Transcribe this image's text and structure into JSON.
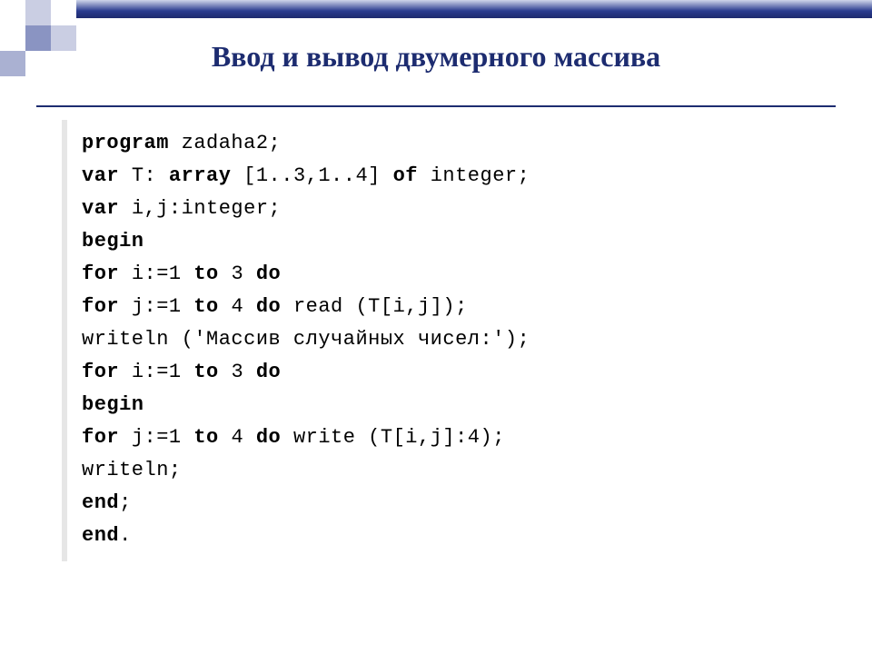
{
  "title": "Ввод и вывод двумерного массива",
  "code": {
    "lines": [
      {
        "segments": [
          {
            "t": "program ",
            "kw": true
          },
          {
            "t": "zadaha2;",
            "kw": false
          }
        ]
      },
      {
        "segments": [
          {
            "t": "var ",
            "kw": true
          },
          {
            "t": "T: ",
            "kw": false
          },
          {
            "t": "array ",
            "kw": true
          },
          {
            "t": "[1..3,1..4] ",
            "kw": false
          },
          {
            "t": "of ",
            "kw": true
          },
          {
            "t": "integer;",
            "kw": false
          }
        ]
      },
      {
        "segments": [
          {
            "t": "var ",
            "kw": true
          },
          {
            "t": "i,j:integer;",
            "kw": false
          }
        ]
      },
      {
        "segments": [
          {
            "t": "begin",
            "kw": true
          }
        ]
      },
      {
        "segments": [
          {
            "t": "for ",
            "kw": true
          },
          {
            "t": "i:=1 ",
            "kw": false
          },
          {
            "t": "to ",
            "kw": true
          },
          {
            "t": "3 ",
            "kw": false
          },
          {
            "t": "do",
            "kw": true
          }
        ]
      },
      {
        "segments": [
          {
            "t": "for ",
            "kw": true
          },
          {
            "t": "j:=1 ",
            "kw": false
          },
          {
            "t": "to ",
            "kw": true
          },
          {
            "t": "4 ",
            "kw": false
          },
          {
            "t": "do ",
            "kw": true
          },
          {
            "t": "read (T[i,j]);",
            "kw": false
          }
        ]
      },
      {
        "segments": [
          {
            "t": "writeln ('Массив случайных чисел:');",
            "kw": false
          }
        ]
      },
      {
        "segments": [
          {
            "t": "for ",
            "kw": true
          },
          {
            "t": "i:=1 ",
            "kw": false
          },
          {
            "t": "to ",
            "kw": true
          },
          {
            "t": "3 ",
            "kw": false
          },
          {
            "t": "do",
            "kw": true
          }
        ]
      },
      {
        "segments": [
          {
            "t": "begin",
            "kw": true
          }
        ]
      },
      {
        "segments": [
          {
            "t": "for ",
            "kw": true
          },
          {
            "t": "j:=1 ",
            "kw": false
          },
          {
            "t": "to ",
            "kw": true
          },
          {
            "t": "4 ",
            "kw": false
          },
          {
            "t": "do ",
            "kw": true
          },
          {
            "t": "write (T[i,j]:4);",
            "kw": false
          }
        ]
      },
      {
        "segments": [
          {
            "t": "writeln;",
            "kw": false
          }
        ]
      },
      {
        "segments": [
          {
            "t": "end",
            "kw": true
          },
          {
            "t": ";",
            "kw": false
          }
        ]
      },
      {
        "segments": [
          {
            "t": "end",
            "kw": true
          },
          {
            "t": ".",
            "kw": false
          }
        ]
      }
    ]
  }
}
